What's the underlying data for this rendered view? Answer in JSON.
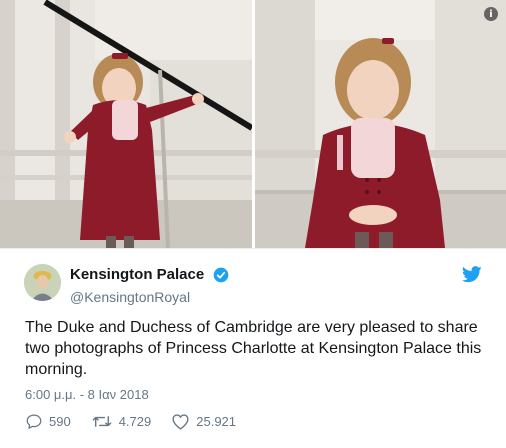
{
  "tweet": {
    "author": {
      "display_name": "Kensington Palace",
      "handle": "@KensingtonRoyal",
      "verified_icon": "verified-badge-icon",
      "avatar_icon": "royal-avatar"
    },
    "text": "The Duke and Duchess of Cambridge are very pleased to share two photographs of Princess Charlotte at Kensington Palace this morning.",
    "timestamp": "6:00 μ.μ. - 8 Ιαν 2018",
    "stats": {
      "replies": "590",
      "retweets": "4.729",
      "likes": "25.921"
    },
    "info_label": "i",
    "brand_icon": "twitter-bird-icon"
  },
  "colors": {
    "coat_red": "#8e1b2a",
    "verified_blue": "#1da1f2",
    "muted_text": "#657786",
    "stone_wall": "#dcd8d2"
  }
}
